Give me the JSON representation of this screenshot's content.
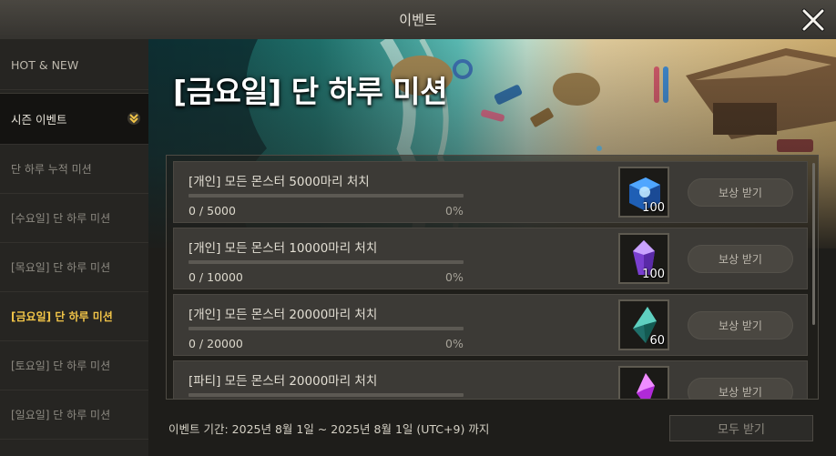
{
  "window": {
    "title": "이벤트"
  },
  "sidebar": {
    "items": [
      {
        "label": "HOT & NEW"
      },
      {
        "label": "시즌 이벤트"
      },
      {
        "label": "단 하루 누적 미션"
      },
      {
        "label": "[수요일] 단 하루 미션"
      },
      {
        "label": "[목요일] 단 하루 미션"
      },
      {
        "label": "[금요일] 단 하루 미션"
      },
      {
        "label": "[토요일] 단 하루 미션"
      },
      {
        "label": "[일요일] 단 하루 미션"
      }
    ]
  },
  "banner": {
    "title": "[금요일] 단 하루 미션"
  },
  "missions": [
    {
      "title": "[개인] 모든 몬스터 5000마리 처치",
      "progress": "0 / 5000",
      "percent": "0%",
      "progress_fraction": 0,
      "reward_icon": "blue-cube-icon",
      "reward_qty": "100",
      "button": "보상 받기"
    },
    {
      "title": "[개인] 모든 몬스터 10000마리 처치",
      "progress": "0 / 10000",
      "percent": "0%",
      "progress_fraction": 0,
      "reward_icon": "purple-crystal-icon",
      "reward_qty": "100",
      "button": "보상 받기"
    },
    {
      "title": "[개인] 모든 몬스터 20000마리 처치",
      "progress": "0 / 20000",
      "percent": "0%",
      "progress_fraction": 0,
      "reward_icon": "teal-crystal-icon",
      "reward_qty": "60",
      "button": "보상 받기"
    },
    {
      "title": "[파티] 모든 몬스터 20000마리 처치",
      "progress": "",
      "percent": "",
      "progress_fraction": 0,
      "reward_icon": "magenta-crystal-icon",
      "reward_qty": "",
      "button": "보상 받기"
    }
  ],
  "footer": {
    "period": "이벤트 기간: 2025년 8월 1일 ~ 2025년 8월 1일 (UTC+9) 까지",
    "claim_all": "모두 받기"
  },
  "colors": {
    "accent": "#f2c548",
    "progress_fill": "#e0b84a"
  }
}
